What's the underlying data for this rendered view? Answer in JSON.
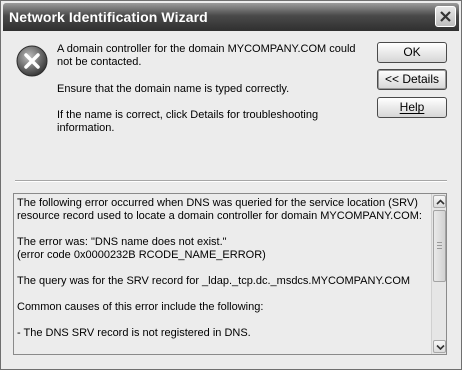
{
  "window": {
    "title": "Network Identification Wizard"
  },
  "message": {
    "line1": "A domain controller for the domain MYCOMPANY.COM could not be contacted.",
    "line2": "Ensure that the domain name is typed correctly.",
    "line3": "If the name is correct, click Details for troubleshooting information."
  },
  "buttons": {
    "ok": "OK",
    "details": "<< Details",
    "help": "Help"
  },
  "details": {
    "paragraphs": [
      "The following error occurred when DNS was queried for the service location (SRV) resource record used to locate a domain controller for domain MYCOMPANY.COM:",
      "The error was: \"DNS name does not exist.\"",
      "(error code 0x0000232B RCODE_NAME_ERROR)",
      "The query was for the SRV record for _ldap._tcp.dc._msdcs.MYCOMPANY.COM",
      "Common causes of this error include the following:",
      "- The DNS SRV record is not registered in DNS."
    ]
  },
  "icons": {
    "error": "error-icon",
    "close": "close-icon"
  }
}
